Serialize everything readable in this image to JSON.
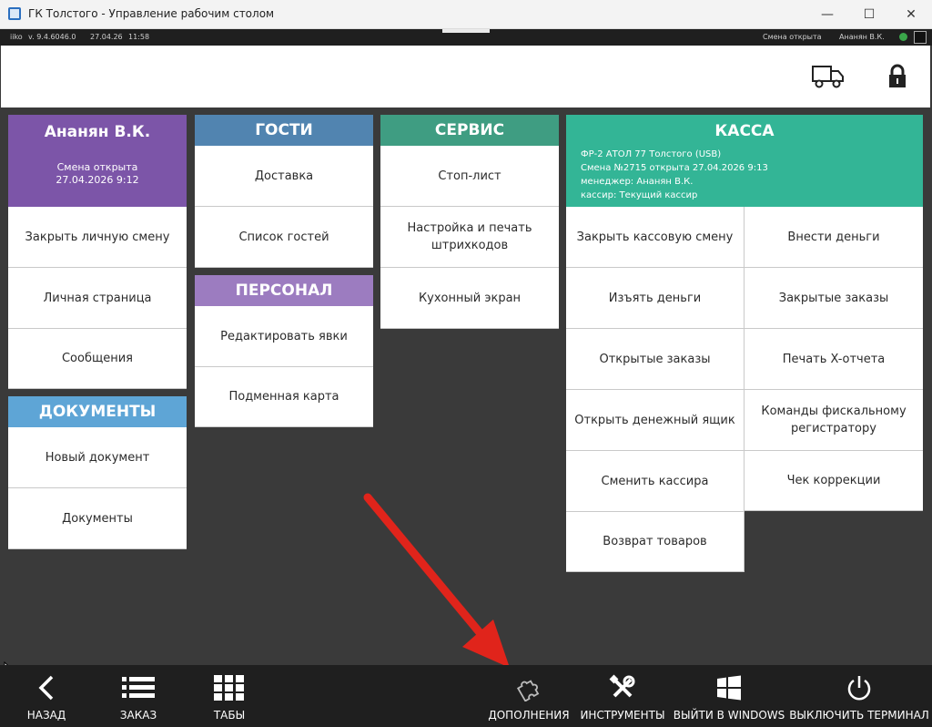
{
  "window": {
    "title": "ГК Толстого - Управление рабочим столом",
    "minimize": "—",
    "maximize": "☐",
    "close": "✕"
  },
  "status": {
    "app": "iiko",
    "version": "v. 9.4.6046.0",
    "date": "27.04.26",
    "time": "11:58",
    "shift": "Смена открыта",
    "user": "Ананян В.К."
  },
  "user_panel": {
    "name": "Ананян В.К.",
    "shift_line1": "Смена открыта",
    "shift_line2": "27.04.2026 9:12",
    "items": [
      "Закрыть личную смену",
      "Личная страница",
      "Сообщения"
    ]
  },
  "documents": {
    "title": "ДОКУМЕНТЫ",
    "items": [
      "Новый документ",
      "Документы"
    ]
  },
  "guests": {
    "title": "ГОСТИ",
    "items": [
      "Доставка",
      "Список гостей"
    ]
  },
  "staff": {
    "title": "ПЕРСОНАЛ",
    "items": [
      "Редактировать явки",
      "Подменная карта"
    ]
  },
  "service": {
    "title": "СЕРВИС",
    "items": [
      "Стоп-лист",
      "Настройка и печать штрихкодов",
      "Кухонный экран"
    ]
  },
  "cash": {
    "title": "КАССА",
    "info": [
      "ФР-2 АТОЛ 77 Толстого (USB)",
      "Смена №2715 открыта 27.04.2026 9:13",
      "менеджер: Ананян В.К.",
      "кассир: Текущий кассир"
    ],
    "left_items": [
      "Закрыть кассовую смену",
      "Изъять деньги",
      "Открытые заказы",
      "Открыть денежный ящик",
      "Сменить кассира",
      "Возврат товаров"
    ],
    "right_items": [
      "Внести деньги",
      "Закрытые заказы",
      "Печать X-отчета",
      "Команды фискальному регистратору",
      "Чек коррекции"
    ]
  },
  "toolbar": {
    "back": "НАЗАД",
    "order": "ЗАКАЗ",
    "tabs": "ТАБЫ",
    "addons": "ДОПОЛНЕНИЯ",
    "tools": "ИНСТРУМЕНТЫ",
    "exit_windows": "ВЫЙТИ В WINDOWS",
    "shutdown": "ВЫКЛЮЧИТЬ ТЕРМИНАЛ"
  },
  "colors": {
    "user": "#7c55a8",
    "guests": "#5184b0",
    "service": "#3f9d82",
    "staff": "#9c7cc0",
    "documents": "#5ea5d6",
    "cash": "#33b596",
    "arrow": "#e0241b"
  }
}
